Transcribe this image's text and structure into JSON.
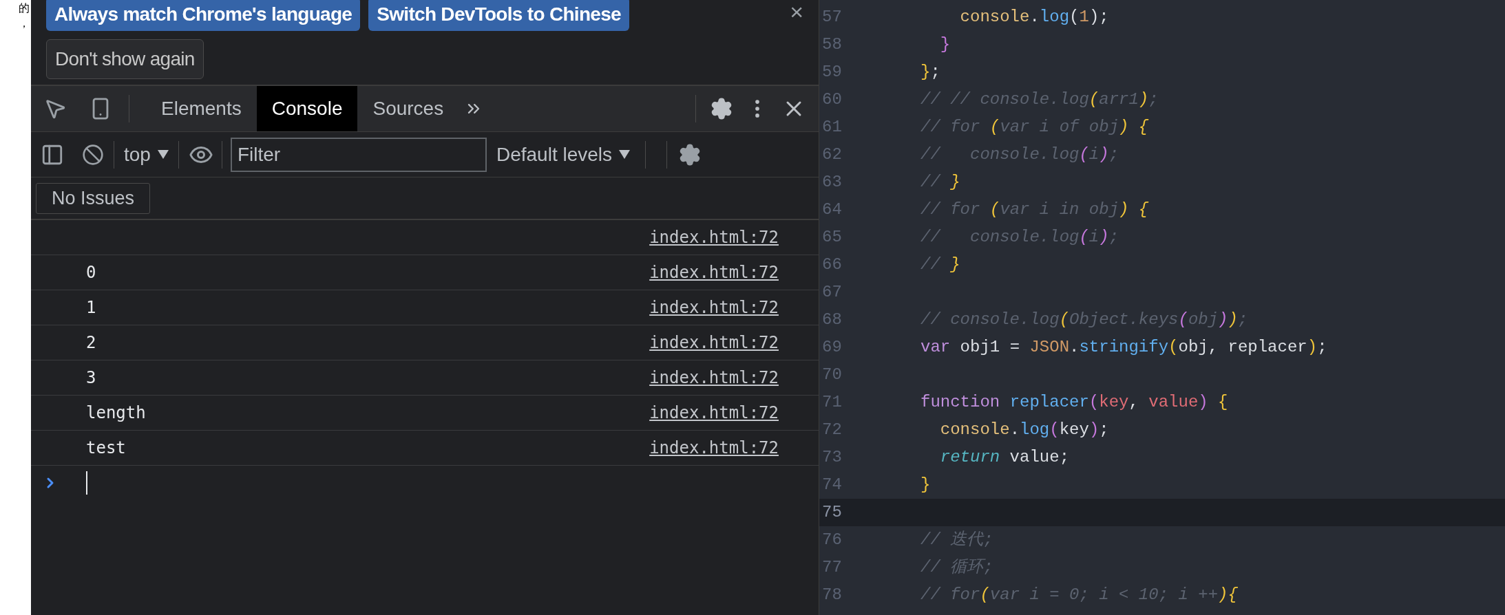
{
  "background_page": {
    "fragments": [
      "的",
      "，"
    ]
  },
  "devtools": {
    "infobar": {
      "buttons": [
        {
          "label": "Always match Chrome's language",
          "kind": "primary"
        },
        {
          "label": "Switch DevTools to Chinese",
          "kind": "primary"
        },
        {
          "label": "Don't show again",
          "kind": "secondary"
        }
      ],
      "close": "×"
    },
    "tabs": [
      {
        "label": "Elements",
        "selected": false
      },
      {
        "label": "Console",
        "selected": true
      },
      {
        "label": "Sources",
        "selected": false
      }
    ],
    "toolbar": {
      "context": "top",
      "filter": {
        "placeholder": "Filter"
      },
      "levels": "Default levels"
    },
    "issues": "No Issues",
    "messages": [
      {
        "source": "index.html:72"
      },
      {
        "text": "0",
        "source": "index.html:72"
      },
      {
        "text": "1",
        "source": "index.html:72"
      },
      {
        "text": "2",
        "source": "index.html:72"
      },
      {
        "text": "3",
        "source": "index.html:72"
      },
      {
        "text": "length",
        "source": "index.html:72"
      },
      {
        "text": "test",
        "source": "index.html:72"
      }
    ]
  },
  "editor": {
    "lines": [
      {
        "number": "57",
        "current": false,
        "tokens": [
          {
            "text": "    console",
            "kind": "obj"
          },
          {
            "text": ".",
            "kind": "plain"
          },
          {
            "text": "log",
            "kind": "fn"
          },
          {
            "text": "(",
            "kind": "plain"
          },
          {
            "text": "1",
            "kind": "num"
          },
          {
            "text": ");",
            "kind": "plain"
          }
        ]
      },
      {
        "number": "58",
        "current": false,
        "tokens": [
          {
            "text": "  }",
            "kind": "brace2"
          }
        ]
      },
      {
        "number": "59",
        "current": false,
        "tokens": [
          {
            "text": "}",
            "kind": "brace"
          },
          {
            "text": ";",
            "kind": "plain"
          }
        ]
      },
      {
        "number": "60",
        "current": false,
        "tokens": [
          {
            "text": "// // console.log",
            "kind": "comment"
          },
          {
            "text": "(",
            "kind": "cbrace"
          },
          {
            "text": "arr1",
            "kind": "comment"
          },
          {
            "text": ")",
            "kind": "cbrace"
          },
          {
            "text": ";",
            "kind": "comment"
          }
        ]
      },
      {
        "number": "61",
        "current": false,
        "tokens": [
          {
            "text": "// for ",
            "kind": "comment"
          },
          {
            "text": "(",
            "kind": "cbrace"
          },
          {
            "text": "var i of obj",
            "kind": "comment"
          },
          {
            "text": ")",
            "kind": "cbrace"
          },
          {
            "text": " {",
            "kind": "cbrace"
          }
        ]
      },
      {
        "number": "62",
        "current": false,
        "tokens": [
          {
            "text": "//   console.log",
            "kind": "comment"
          },
          {
            "text": "(",
            "kind": "cbrace2"
          },
          {
            "text": "i",
            "kind": "comment"
          },
          {
            "text": ")",
            "kind": "cbrace2"
          },
          {
            "text": ";",
            "kind": "comment"
          }
        ]
      },
      {
        "number": "63",
        "current": false,
        "tokens": [
          {
            "text": "// ",
            "kind": "comment"
          },
          {
            "text": "}",
            "kind": "cbrace"
          }
        ]
      },
      {
        "number": "64",
        "current": false,
        "tokens": [
          {
            "text": "// for ",
            "kind": "comment"
          },
          {
            "text": "(",
            "kind": "cbrace"
          },
          {
            "text": "var i in obj",
            "kind": "comment"
          },
          {
            "text": ")",
            "kind": "cbrace"
          },
          {
            "text": " {",
            "kind": "cbrace"
          }
        ]
      },
      {
        "number": "65",
        "current": false,
        "tokens": [
          {
            "text": "//   console.log",
            "kind": "comment"
          },
          {
            "text": "(",
            "kind": "cbrace2"
          },
          {
            "text": "i",
            "kind": "comment"
          },
          {
            "text": ")",
            "kind": "cbrace2"
          },
          {
            "text": ";",
            "kind": "comment"
          }
        ]
      },
      {
        "number": "66",
        "current": false,
        "tokens": [
          {
            "text": "// ",
            "kind": "comment"
          },
          {
            "text": "}",
            "kind": "cbrace"
          }
        ]
      },
      {
        "number": "67",
        "current": false
      },
      {
        "number": "68",
        "current": false,
        "tokens": [
          {
            "text": "// console.log",
            "kind": "comment"
          },
          {
            "text": "(",
            "kind": "cbrace"
          },
          {
            "text": "Object.keys",
            "kind": "comment"
          },
          {
            "text": "(",
            "kind": "cbrace2"
          },
          {
            "text": "obj",
            "kind": "comment"
          },
          {
            "text": ")",
            "kind": "cbrace2"
          },
          {
            "text": ")",
            "kind": "cbrace"
          },
          {
            "text": ";",
            "kind": "comment"
          }
        ]
      },
      {
        "number": "69",
        "current": false,
        "tokens": [
          {
            "text": "var",
            "kind": "kw"
          },
          {
            "text": " obj1 = ",
            "kind": "plain"
          },
          {
            "text": "JSON",
            "kind": "num"
          },
          {
            "text": ".",
            "kind": "plain"
          },
          {
            "text": "stringify",
            "kind": "fn"
          },
          {
            "text": "(",
            "kind": "brace"
          },
          {
            "text": "obj, replacer",
            "kind": "plain"
          },
          {
            "text": ")",
            "kind": "brace"
          },
          {
            "text": ";",
            "kind": "plain"
          }
        ]
      },
      {
        "number": "70",
        "current": false
      },
      {
        "number": "71",
        "current": false,
        "tokens": [
          {
            "text": "function ",
            "kind": "kw"
          },
          {
            "text": "replacer",
            "kind": "fn"
          },
          {
            "text": "(",
            "kind": "brace2"
          },
          {
            "text": "key",
            "kind": "param"
          },
          {
            "text": ", ",
            "kind": "plain"
          },
          {
            "text": "value",
            "kind": "param"
          },
          {
            "text": ")",
            "kind": "brace2"
          },
          {
            "text": " {",
            "kind": "brace"
          }
        ]
      },
      {
        "number": "72",
        "current": false,
        "tokens": [
          {
            "text": "  console",
            "kind": "obj"
          },
          {
            "text": ".",
            "kind": "plain"
          },
          {
            "text": "log",
            "kind": "fn"
          },
          {
            "text": "(",
            "kind": "brace2"
          },
          {
            "text": "key",
            "kind": "plain"
          },
          {
            "text": ")",
            "kind": "brace2"
          },
          {
            "text": ";",
            "kind": "plain"
          }
        ]
      },
      {
        "number": "73",
        "current": false,
        "tokens": [
          {
            "text": "  return",
            "kind": "ret"
          },
          {
            "text": " value;",
            "kind": "plain"
          }
        ]
      },
      {
        "number": "74",
        "current": false,
        "tokens": [
          {
            "text": "}",
            "kind": "brace"
          }
        ]
      },
      {
        "number": "75",
        "current": true
      },
      {
        "number": "76",
        "current": false,
        "tokens": [
          {
            "text": "// 迭代;",
            "kind": "comment"
          }
        ]
      },
      {
        "number": "77",
        "current": false,
        "tokens": [
          {
            "text": "// 循环;",
            "kind": "comment"
          }
        ]
      },
      {
        "number": "78",
        "current": false,
        "tokens": [
          {
            "text": "// for",
            "kind": "comment"
          },
          {
            "text": "(",
            "kind": "cbrace"
          },
          {
            "text": "var i = 0; i < 10; i ++",
            "kind": "comment"
          },
          {
            "text": ")",
            "kind": "cbrace"
          },
          {
            "text": "{",
            "kind": "cbrace"
          }
        ]
      }
    ]
  }
}
